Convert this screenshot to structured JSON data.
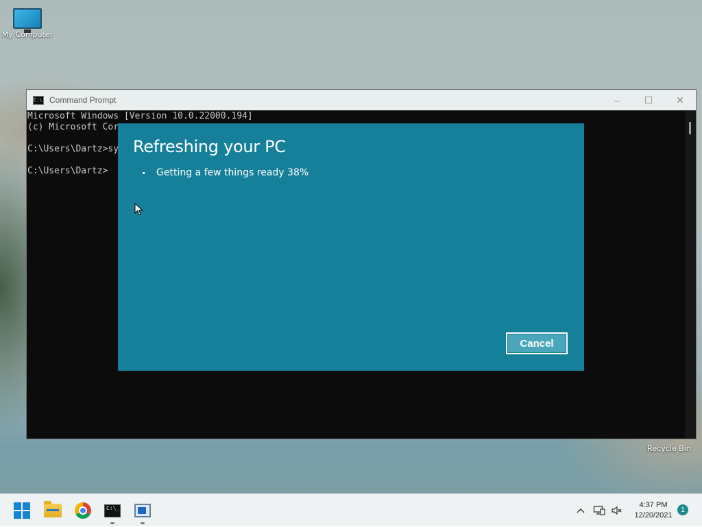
{
  "desktop": {
    "icons": [
      {
        "label": "My Computer"
      },
      {
        "label": "Recycle Bin"
      }
    ]
  },
  "cmd_window": {
    "title": "Command Prompt",
    "lines": [
      "Microsoft Windows [Version 10.0.22000.194]",
      "(c) Microsoft Cor",
      "",
      "C:\\Users\\Dartz>sy",
      "",
      "C:\\Users\\Dartz>"
    ],
    "buttons": {
      "minimize": "–",
      "maximize": "☐",
      "close": "✕"
    }
  },
  "refresh_dialog": {
    "title": "Refreshing your PC",
    "step_label": "Getting a few things ready",
    "progress_text": "38%",
    "progress_percent": 38,
    "cancel_label": "Cancel"
  },
  "taskbar": {
    "apps": [
      {
        "name": "start",
        "icon": "windows-logo-icon"
      },
      {
        "name": "file-explorer",
        "icon": "folder-icon"
      },
      {
        "name": "chrome",
        "icon": "chrome-icon"
      },
      {
        "name": "command-prompt",
        "icon": "terminal-icon",
        "running": true
      },
      {
        "name": "app",
        "icon": "window-app-icon",
        "running": true
      }
    ],
    "tray": {
      "chevron": "^",
      "time": "4:37 PM",
      "date": "12/20/2021",
      "notification_count": "1"
    }
  },
  "colors": {
    "dialog_bg": "#16809a",
    "cancel_bg": "#4aa6ba",
    "cmd_bg": "#0c0c0c",
    "accent_blue": "#1485d6"
  }
}
